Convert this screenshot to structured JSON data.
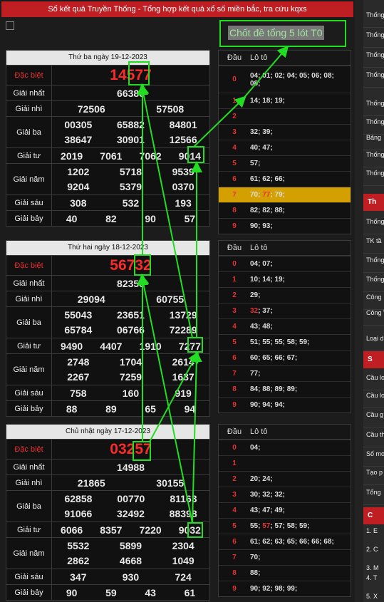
{
  "header": {
    "title": "Sổ kết quả Truyền Thống - Tổng hợp kết quả xổ số miền bắc, tra cứu kqxs"
  },
  "callout": {
    "text": "Chốt đề tổng 5 lót T0"
  },
  "prize_labels": {
    "special": "Đặc biệt",
    "first": "Giải nhất",
    "second": "Giải nhì",
    "third": "Giải ba",
    "fourth": "Giải tư",
    "fifth": "Giải năm",
    "sixth": "Giải sáu",
    "seventh": "Giải bảy"
  },
  "loto_header": {
    "head": "Đầu",
    "tail": "Lô tô"
  },
  "days": [
    {
      "date": "Thứ ba ngày 19-12-2023",
      "special": "14577",
      "first": "66386",
      "second": [
        "72506",
        "57508"
      ],
      "third": [
        [
          "00305",
          "65882",
          "84801"
        ],
        [
          "38647",
          "30901",
          "12566"
        ]
      ],
      "fourth": [
        "2019",
        "7061",
        "7062",
        "9014"
      ],
      "fifth": [
        [
          "1202",
          "5718",
          "9539"
        ],
        [
          "9204",
          "5379",
          "0370"
        ]
      ],
      "sixth": [
        "308",
        "532",
        "193"
      ],
      "seventh": [
        "40",
        "82",
        "90",
        "57"
      ],
      "loto": [
        [
          "0",
          "04; 01; 02; 04; 05; 06; 08;\n08;"
        ],
        [
          "1",
          "14; 18; 19;"
        ],
        [
          "2",
          ""
        ],
        [
          "3",
          "32; 39;"
        ],
        [
          "4",
          "40; 47;"
        ],
        [
          "5",
          "57;"
        ],
        [
          "6",
          "61; 62; 66;"
        ],
        [
          "7",
          "70; 77; 79;"
        ],
        [
          "8",
          "82; 82; 88;"
        ],
        [
          "9",
          "90; 93;"
        ]
      ]
    },
    {
      "date": "Thứ hai ngày 18-12-2023",
      "special": "56732",
      "first": "82350",
      "second": [
        "29094",
        "60755"
      ],
      "third": [
        [
          "55043",
          "23651",
          "13729"
        ],
        [
          "65784",
          "06766",
          "72289"
        ]
      ],
      "fourth": [
        "9490",
        "4407",
        "1910",
        "7277"
      ],
      "fifth": [
        [
          "2748",
          "1704",
          "2614"
        ],
        [
          "2267",
          "7259",
          "1637"
        ]
      ],
      "sixth": [
        "758",
        "160",
        "919"
      ],
      "seventh": [
        "88",
        "89",
        "65",
        "94"
      ],
      "loto": [
        [
          "0",
          "04; 07;"
        ],
        [
          "1",
          "10; 14; 19;"
        ],
        [
          "2",
          "29;"
        ],
        [
          "3",
          "32; 37;"
        ],
        [
          "4",
          "43; 48;"
        ],
        [
          "5",
          "51; 55; 55; 58; 59;"
        ],
        [
          "6",
          "60; 65; 66; 67;"
        ],
        [
          "7",
          "77;"
        ],
        [
          "8",
          "84; 88; 89; 89;"
        ],
        [
          "9",
          "90; 94; 94;"
        ]
      ]
    },
    {
      "date": "Chủ nhật ngày 17-12-2023",
      "special": "03257",
      "first": "14988",
      "second": [
        "21865",
        "30155"
      ],
      "third": [
        [
          "62858",
          "00770",
          "81163"
        ],
        [
          "91066",
          "32492",
          "88398"
        ]
      ],
      "fourth": [
        "6066",
        "8357",
        "7220",
        "9032"
      ],
      "fifth": [
        [
          "5532",
          "5899",
          "2304"
        ],
        [
          "2862",
          "4668",
          "1049"
        ]
      ],
      "sixth": [
        "347",
        "930",
        "724"
      ],
      "seventh": [
        "90",
        "59",
        "43",
        "61"
      ],
      "loto": [
        [
          "0",
          "04;"
        ],
        [
          "1",
          ""
        ],
        [
          "2",
          "20; 24;"
        ],
        [
          "3",
          "30; 32; 32;"
        ],
        [
          "4",
          "43; 47; 49;"
        ],
        [
          "5",
          "55; 57; 57; 58; 59;"
        ],
        [
          "6",
          "61; 62; 63; 65; 66; 66; 68;"
        ],
        [
          "7",
          "70;"
        ],
        [
          "8",
          "88;"
        ],
        [
          "9",
          "90; 92; 98; 99;"
        ]
      ]
    }
  ],
  "sidebar": {
    "items": [
      "Thống",
      "Thống loto",
      "Thống",
      "Thống loto",
      "Thống",
      "Thống",
      "Bảng",
      "Thống theo E",
      "Thống",
      "Thống",
      "TK tầ",
      "Thống",
      "Thống",
      "Công",
      "Công VIP",
      "Loại d",
      "Cầu lo",
      "Cầu lo",
      "Cầu g",
      "Cầu th",
      "Số mo",
      "Tạo p",
      "Tổng"
    ],
    "heads": [
      "Th",
      "S",
      "C"
    ],
    "list": [
      "1. E",
      "2. C",
      "3. M",
      "4. T",
      "5. X"
    ]
  },
  "colors": {
    "accent": "#bf1e22",
    "arrow": "#22dd22",
    "highlight": "#d4a000"
  }
}
